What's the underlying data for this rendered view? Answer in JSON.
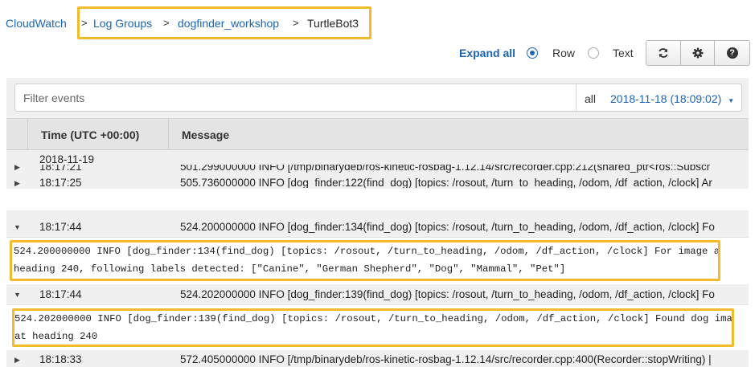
{
  "breadcrumb": {
    "root": "CloudWatch",
    "items": [
      "Log Groups",
      "dogfinder_workshop"
    ],
    "current": "TurtleBot3",
    "separator": ">"
  },
  "toolbar": {
    "expand_all": "Expand all",
    "view_options": [
      {
        "label": "Row",
        "selected": true
      },
      {
        "label": "Text",
        "selected": false
      }
    ],
    "buttons": [
      {
        "icon": "refresh-icon"
      },
      {
        "icon": "gear-icon"
      },
      {
        "icon": "help-icon",
        "glyph": "?"
      }
    ]
  },
  "filter": {
    "placeholder": "Filter events",
    "range_label": "all",
    "date": "2018-11-18 (18:09:02)"
  },
  "table": {
    "columns": [
      "Time (UTC +00:00)",
      "Message"
    ],
    "date_group": "2018-11-19",
    "rows": [
      {
        "time": "18:17:21",
        "message": "501.299000000 INFO [/tmp/binarydeb/ros-kinetic-rosbag-1.12.14/src/recorder.cpp:212(shared_ptr<ros::Subscr",
        "expanded": false
      },
      {
        "time": "18:17:25",
        "message": "505.736000000 INFO [dog_finder:122(find_dog) [topics: /rosout, /turn_to_heading, /odom, /df_action, /clock] Ar",
        "expanded": false
      },
      {
        "time": "18:17:44",
        "message": "524.200000000 INFO [dog_finder:134(find_dog) [topics: /rosout, /turn_to_heading, /odom, /df_action, /clock] Fo",
        "expanded": true,
        "detail": [
          "524.200000000 INFO [dog_finder:134(find_dog) [topics: /rosout, /turn_to_heading, /odom, /df_action, /clock] For image at",
          "heading 240, following labels detected: [\"Canine\", \"German Shepherd\", \"Dog\", \"Mammal\", \"Pet\"]"
        ]
      },
      {
        "time": "18:17:44",
        "message": "524.202000000 INFO [dog_finder:139(find_dog) [topics: /rosout, /turn_to_heading, /odom, /df_action, /clock] Fo",
        "expanded": true,
        "detail": [
          "524.202000000 INFO [dog_finder:139(find_dog) [topics: /rosout, /turn_to_heading, /odom, /df_action, /clock] Found dog image",
          "at heading 240"
        ]
      },
      {
        "time": "18:18:33",
        "message": "572.405000000 INFO [/tmp/binarydeb/ros-kinetic-rosbag-1.12.14/src/recorder.cpp:400(Recorder::stopWriting) |",
        "expanded": false
      }
    ]
  },
  "colors": {
    "link": "#1a65b5",
    "highlight": "#f2bb2b"
  }
}
